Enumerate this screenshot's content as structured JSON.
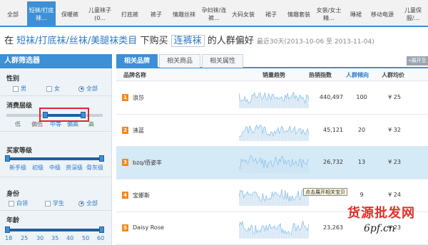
{
  "categories": [
    {
      "label": "全部"
    },
    {
      "label": "短袜/打底\n袜..."
    },
    {
      "label": "保暖裤"
    },
    {
      "label": "儿童袜子\n(0..."
    },
    {
      "label": "打底裤"
    },
    {
      "label": "裤子"
    },
    {
      "label": "情趣丝袜"
    },
    {
      "label": "孕妇袜/连\n裤..."
    },
    {
      "label": "大码女装"
    },
    {
      "label": "裙子"
    },
    {
      "label": "情趣套装"
    },
    {
      "label": "女装/女士\n精..."
    },
    {
      "label": "睡裙"
    },
    {
      "label": "移动电源"
    },
    {
      "label": "儿童保\n服/..."
    }
  ],
  "headline": {
    "prefix": "在",
    "cat1": "短袜/打底袜/丝袜/美腿袜类目",
    "mid": "下购买",
    "keyword": "连裤袜",
    "suffix": "的人群偏好",
    "range": "最近30天(2013-10-06 至 2013-11-04)"
  },
  "filter": {
    "title": "人群筛选器",
    "gender": {
      "title": "性别",
      "options": [
        "男",
        "女",
        "全部"
      ],
      "selected": "全部"
    },
    "consumption": {
      "title": "消费层级",
      "labels": [
        "低",
        "偏低",
        "中等",
        "偏高",
        "高"
      ],
      "selected_from": "中等",
      "selected_to": "偏高"
    },
    "buyer_level": {
      "title": "买家等级",
      "labels": [
        "新手级",
        "初级",
        "中级",
        "资深级",
        "骨灰级"
      ]
    },
    "identity": {
      "title": "身份",
      "options": [
        "白领",
        "学生",
        "全部"
      ],
      "selected": "全部"
    },
    "age": {
      "title": "年龄",
      "labels": [
        "18",
        "25",
        "30",
        "35",
        "40",
        "50",
        "60"
      ]
    }
  },
  "tabs": [
    {
      "label": "相关品牌",
      "active": true
    },
    {
      "label": "相关商品",
      "active": false
    },
    {
      "label": "相关属性",
      "active": false
    }
  ],
  "collapse_label": "«展开至",
  "table": {
    "headers": [
      "品牌名称",
      "销量趋势",
      "热销指数",
      "人群倾向",
      "人群均价"
    ],
    "rows": [
      {
        "rank": "1",
        "name": "浪莎",
        "hot": "440,497",
        "tendency": "100",
        "price": "¥ 25"
      },
      {
        "rank": "2",
        "name": "沸蓝",
        "hot": "45,121",
        "tendency": "20",
        "price": "¥ 32"
      },
      {
        "rank": "3",
        "name": "bzq/佰姿丰",
        "hot": "26,732",
        "tendency": "13",
        "price": "¥ 23"
      },
      {
        "rank": "4",
        "name": "宝娜斯",
        "hot": "",
        "tendency": "9",
        "price": "¥ 24"
      },
      {
        "rank": "5",
        "name": "Daisy Rose",
        "hot": "23,263",
        "tendency": "",
        "price": "¥ 23"
      }
    ]
  },
  "tooltip": "点击展开相关宝贝",
  "watermark": {
    "line1": "货源批发网",
    "line2": "6pf.cn"
  },
  "colors": {
    "accent": "#3d8fd6",
    "rank_badge": "#f08a1c",
    "highlight_row": "#d4eaf6",
    "slider_box": "#e0262a"
  }
}
